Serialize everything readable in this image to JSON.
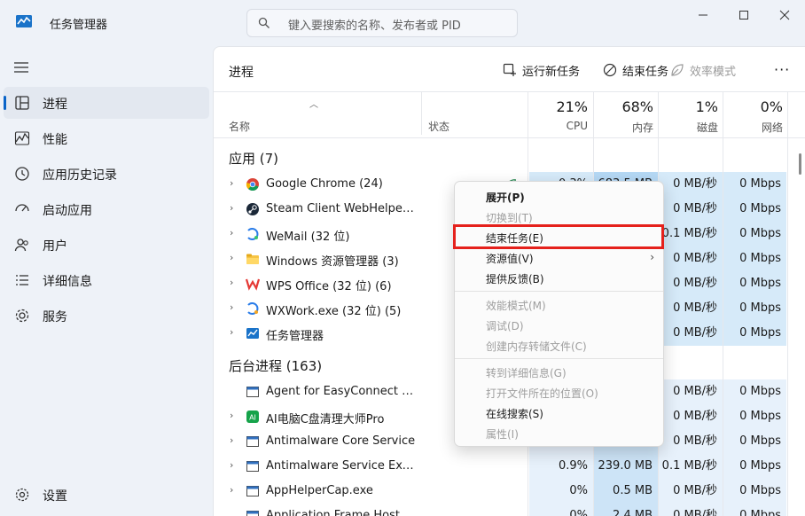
{
  "window": {
    "title": "任务管理器",
    "search_placeholder": "键入要搜索的名称、发布者或 PID"
  },
  "sidebar": {
    "items": [
      {
        "label": "进程",
        "icon": "processes-icon",
        "active": true
      },
      {
        "label": "性能",
        "icon": "performance-icon"
      },
      {
        "label": "应用历史记录",
        "icon": "app-history-icon"
      },
      {
        "label": "启动应用",
        "icon": "startup-icon"
      },
      {
        "label": "用户",
        "icon": "users-icon"
      },
      {
        "label": "详细信息",
        "icon": "details-icon"
      },
      {
        "label": "服务",
        "icon": "services-icon"
      }
    ],
    "settings_label": "设置"
  },
  "toolbar": {
    "page_title": "进程",
    "run_new_task": "运行新任务",
    "end_task": "结束任务",
    "efficiency_mode": "效率模式",
    "more": "···"
  },
  "columns": {
    "name": "名称",
    "status": "状态",
    "cpu_pct": "21%",
    "cpu": "CPU",
    "mem_pct": "68%",
    "mem": "内存",
    "disk_pct": "1%",
    "disk": "磁盘",
    "net_pct": "0%",
    "net": "网络"
  },
  "sections": {
    "apps": "应用 (7)",
    "background": "后台进程 (163)"
  },
  "apps": [
    {
      "name": "Google Chrome (24)",
      "icon": "chrome-icon",
      "cpu": "0.3%",
      "mem": "683.5 MB",
      "disk": "0 MB/秒",
      "net": "0 Mbps",
      "status_icon": "eco-leaf-icon"
    },
    {
      "name": "Steam Client WebHelper (8)",
      "icon": "steam-icon",
      "cpu": "",
      "mem": "",
      "disk": "0 MB/秒",
      "net": "0 Mbps"
    },
    {
      "name": "WeMail (32 位)",
      "icon": "wemail-icon",
      "cpu": "",
      "mem": "",
      "disk": "0.1 MB/秒",
      "net": "0 Mbps"
    },
    {
      "name": "Windows 资源管理器 (3)",
      "icon": "explorer-icon",
      "cpu": "",
      "mem": "",
      "disk": "0 MB/秒",
      "net": "0 Mbps"
    },
    {
      "name": "WPS Office (32 位) (6)",
      "icon": "wps-icon",
      "cpu": "",
      "mem": "",
      "disk": "0 MB/秒",
      "net": "0 Mbps"
    },
    {
      "name": "WXWork.exe (32 位) (5)",
      "icon": "wxwork-icon",
      "cpu": "",
      "mem": "",
      "disk": "0 MB/秒",
      "net": "0 Mbps"
    },
    {
      "name": "任务管理器",
      "icon": "taskmgr-icon",
      "cpu": "",
      "mem": "",
      "disk": "0 MB/秒",
      "net": "0 Mbps"
    }
  ],
  "background": [
    {
      "name": "Agent for EasyConnect (32 ...",
      "icon": "app-window-icon",
      "expand": false,
      "cpu": "",
      "mem": "",
      "disk": "0 MB/秒",
      "net": "0 Mbps"
    },
    {
      "name": "AI电脑C盘清理大师Pro",
      "icon": "ai-cleaner-icon",
      "expand": true,
      "cpu": "",
      "mem": "",
      "disk": "0 MB/秒",
      "net": "0 Mbps"
    },
    {
      "name": "Antimalware Core Service",
      "icon": "app-window-icon",
      "expand": true,
      "cpu": "",
      "mem": "",
      "disk": "0 MB/秒",
      "net": "0 Mbps"
    },
    {
      "name": "Antimalware Service Executable",
      "icon": "app-window-icon",
      "expand": true,
      "cpu": "0.9%",
      "mem": "239.0 MB",
      "disk": "0.1 MB/秒",
      "net": "0 Mbps"
    },
    {
      "name": "AppHelperCap.exe",
      "icon": "app-window-icon",
      "expand": true,
      "cpu": "0%",
      "mem": "0.5 MB",
      "disk": "0 MB/秒",
      "net": "0 Mbps"
    },
    {
      "name": "Application Frame Host",
      "icon": "app-window-icon",
      "expand": false,
      "cpu": "0%",
      "mem": "2.4 MB",
      "disk": "0 MB/秒",
      "net": "0 Mbps"
    }
  ],
  "context_menu": {
    "items": [
      {
        "label": "展开(P)",
        "disabled": false,
        "bold": true
      },
      {
        "label": "切换到(T)",
        "disabled": true
      },
      {
        "label": "结束任务(E)",
        "disabled": false
      },
      {
        "label": "资源值(V)",
        "disabled": false,
        "submenu": "›"
      },
      {
        "label": "提供反馈(B)",
        "disabled": false
      },
      {
        "label": "效能模式(M)",
        "disabled": true
      },
      {
        "label": "调试(D)",
        "disabled": true
      },
      {
        "label": "创建内存转储文件(C)",
        "disabled": true
      },
      {
        "label": "转到详细信息(G)",
        "disabled": true
      },
      {
        "label": "打开文件所在的位置(O)",
        "disabled": true
      },
      {
        "label": "在线搜索(S)",
        "disabled": false
      },
      {
        "label": "属性(I)",
        "disabled": true
      }
    ]
  },
  "colors": {
    "accent": "#0a64c8",
    "cpu_heat": "#cfe6f8",
    "mem_heat_hi": "#a8d2f2",
    "highlight_border": "#e5211c"
  }
}
